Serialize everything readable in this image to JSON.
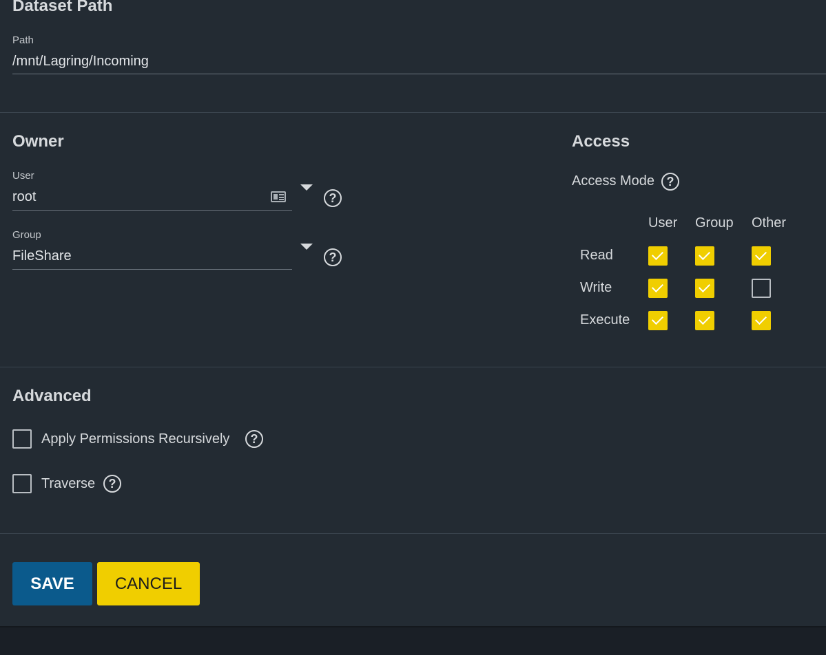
{
  "dataset": {
    "title": "Dataset Path",
    "path_label": "Path",
    "path_value": "/mnt/Lagring/Incoming"
  },
  "owner": {
    "title": "Owner",
    "user_label": "User",
    "user_value": "root",
    "group_label": "Group",
    "group_value": "FileShare"
  },
  "access": {
    "title": "Access",
    "mode_label": "Access Mode",
    "columns": [
      "User",
      "Group",
      "Other"
    ],
    "rows": [
      {
        "label": "Read",
        "values": [
          true,
          true,
          true
        ]
      },
      {
        "label": "Write",
        "values": [
          true,
          true,
          false
        ]
      },
      {
        "label": "Execute",
        "values": [
          true,
          true,
          true
        ]
      }
    ]
  },
  "advanced": {
    "title": "Advanced",
    "recursive_label": "Apply Permissions Recursively",
    "recursive_checked": false,
    "traverse_label": "Traverse",
    "traverse_checked": false
  },
  "actions": {
    "save_label": "SAVE",
    "cancel_label": "CANCEL"
  },
  "colors": {
    "accent": "#f0ce00",
    "primary": "#0b5a8c",
    "card": "#232b33",
    "background": "#1a1f26"
  }
}
